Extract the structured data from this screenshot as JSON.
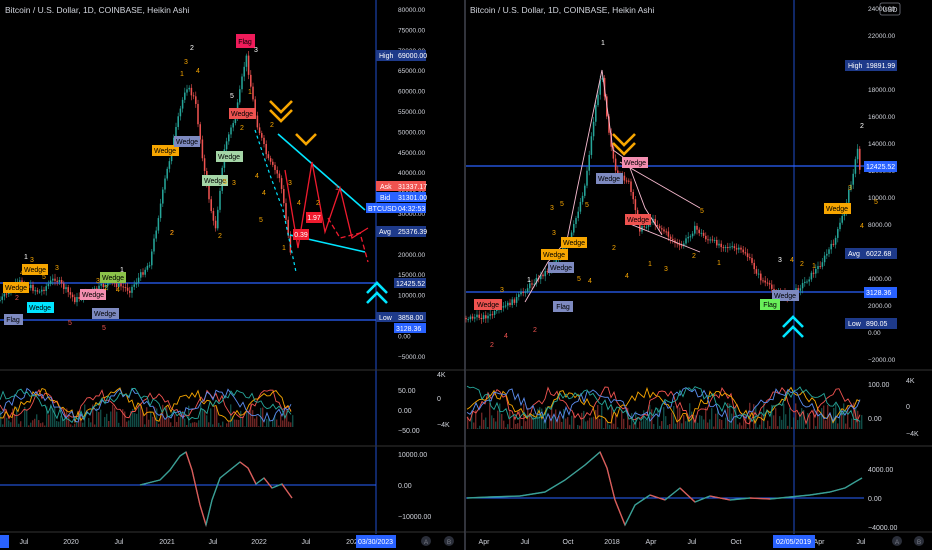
{
  "colors": {
    "background": "#000000",
    "up": "#26a69a",
    "down": "#ef5350",
    "cyan": "#00e5ff",
    "orange": "#f7a600",
    "blue_line": "#2962ff",
    "price_label": "#1e3a8a",
    "text": "#d1d4dc"
  },
  "left": {
    "title": "Bitcoin / U.S. Dollar, 1D, COINBASE, Heikin Ashi",
    "price_axis": [
      "80000.00",
      "75000.00",
      "70000.00",
      "65000.00",
      "60000.00",
      "55000.00",
      "50000.00",
      "45000.00",
      "40000.00",
      "35000.00",
      "30000.00",
      "25000.00",
      "20000.00",
      "15000.00",
      "10000.00",
      "5000.00",
      "0.00",
      "−5000.00"
    ],
    "labels": {
      "high_label": "High",
      "high_value": "69000.00",
      "ask_label": "Ask",
      "ask_value": "31337.17",
      "bid_label": "Bid",
      "bid_value": "31301.00",
      "symbol": "BTCUSD",
      "countdown": "04:32:53",
      "avg_label": "Avg",
      "avg_value": "25376.39",
      "line_value": "12425.52",
      "low_label": "Low",
      "low_value": "3858.00",
      "low_line_value": "3128.36"
    },
    "time_axis": [
      "9",
      "Jul",
      "2020",
      "Jul",
      "2021",
      "Jul",
      "2022",
      "Jul",
      "202"
    ],
    "time_cursor": "03/30/2023",
    "osc1_axis": [
      "50.00",
      "0.00",
      "−50.00"
    ],
    "osc1_axis_right": [
      "4K",
      "0",
      "−4K"
    ],
    "osc2_axis": [
      "10000.00",
      "0.00",
      "−10000.00"
    ],
    "tags": {
      "wedge": "Wedge",
      "flag": "Flag",
      "box_a": "1.97",
      "box_b": "0.39"
    },
    "wave_numbers": [
      "1",
      "3",
      "2",
      "4",
      "5",
      "3",
      "5",
      "1",
      "2",
      "3",
      "4",
      "5",
      "2",
      "2",
      "1",
      "2",
      "3",
      "4",
      "5",
      "3",
      "2",
      "1",
      "4",
      "2",
      "5",
      "3",
      "4",
      "2",
      "1",
      "3",
      "5",
      "4",
      "2",
      "1"
    ]
  },
  "right": {
    "title": "Bitcoin / U.S. Dollar, 1D, COINBASE, Heikin Ashi",
    "currency": "USD",
    "price_axis": [
      "24000.00",
      "22000.00",
      "20000.00",
      "18000.00",
      "16000.00",
      "14000.00",
      "12000.00",
      "10000.00",
      "8000.00",
      "6000.00",
      "4000.00",
      "2000.00",
      "0.00",
      "−2000.00"
    ],
    "labels": {
      "high_label": "High",
      "high_value": "19891.99",
      "line_value": "12425.52",
      "avg_label": "Avg",
      "avg_value": "6022.68",
      "low_line_value": "3128.36",
      "low_label": "Low",
      "low_value": "890.05"
    },
    "time_axis": [
      "Apr",
      "Jul",
      "Oct",
      "2018",
      "Apr",
      "Jul",
      "Oct",
      "2",
      "Apr",
      "Jul"
    ],
    "time_cursor": "02/05/2019",
    "osc1_axis": [
      "100.00",
      "0.00"
    ],
    "osc1_axis_right": [
      "4K",
      "0",
      "−4K"
    ],
    "osc2_axis": [
      "4000.00",
      "0.00",
      "−4000.00"
    ],
    "tags": {
      "wedge": "Wedge",
      "flag": "Flag"
    },
    "wave_numbers": [
      "1",
      "2",
      "3",
      "4",
      "5",
      "3",
      "5",
      "1",
      "2",
      "3",
      "4",
      "5",
      "4",
      "2",
      "1",
      "3",
      "5",
      "2",
      "1",
      "3",
      "4",
      "2",
      "1",
      "2",
      "3",
      "4",
      "5"
    ]
  }
}
